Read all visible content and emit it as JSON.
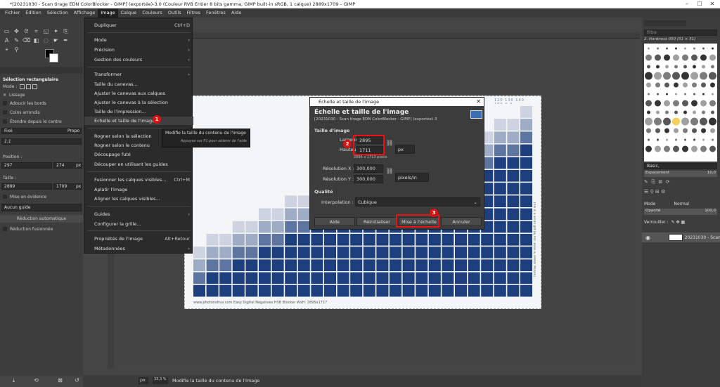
{
  "window": {
    "title": "*[20231030 - Scan tirage EDN ColorBlocker - GIMP] (exportée)-3.0 (Couleur RVB Entier 8 bits gamma, GIMP built-in sRGB, 1 calque) 2889x1709 – GIMP"
  },
  "menubar": [
    "Fichier",
    "Édition",
    "Sélection",
    "Affichage",
    "Image",
    "Calque",
    "Couleurs",
    "Outils",
    "Filtres",
    "Fenêtres",
    "Aide"
  ],
  "image_menu": {
    "items": [
      {
        "label": "Dupliquer",
        "shortcut": "Ctrl+D"
      },
      {
        "label": "Mode",
        "submenu": true
      },
      {
        "label": "Précision",
        "submenu": true
      },
      {
        "label": "Gestion des couleurs",
        "submenu": true
      },
      {
        "label": "Transformer",
        "submenu": true
      },
      {
        "label": "Taille du canevas..."
      },
      {
        "label": "Ajuster le canevas aux calques"
      },
      {
        "label": "Ajuster le canevas à la sélection"
      },
      {
        "label": "Taille de l'impression..."
      },
      {
        "label": "Échelle et taille de l'image..."
      },
      {
        "label": "Rogner selon la sélection"
      },
      {
        "label": "Rogner selon le contenu"
      },
      {
        "label": "Découpage futé"
      },
      {
        "label": "Découper en utilisant les guides"
      },
      {
        "label": "Fusionner les calques visibles...",
        "shortcut": "Ctrl+M"
      },
      {
        "label": "Aplatir l'image"
      },
      {
        "label": "Aligner les calques visibles..."
      },
      {
        "label": "Guides",
        "submenu": true
      },
      {
        "label": "Configurer la grille..."
      },
      {
        "label": "Propriétés de l'image",
        "shortcut": "Alt+Retour"
      },
      {
        "label": "Métadonnées",
        "submenu": true
      }
    ]
  },
  "tooltip": {
    "title": "Modifie la taille du contenu de l'image",
    "hint": "Appuyez sur F1 pour obtenir de l'aide"
  },
  "tool_options": {
    "title": "Sélection rectangulaire",
    "mode_label": "Mode :",
    "lissage": "Lissage",
    "adoucir": "Adoucir les bords",
    "coins": "Coins arrondis",
    "etendre": "Étendre depuis le centre",
    "fixe": "Fixé",
    "proportions": "Propo",
    "ratio": "1:1",
    "position_label": "Position :",
    "pos_x": "297",
    "pos_y": "274",
    "taille_label": "Taille :",
    "size_w": "2889",
    "size_h": "1709",
    "evidence": "Mise en évidence",
    "guide": "Aucun guide",
    "reduction_auto": "Réduction automatique",
    "reduction_fus": "Réduction fusionnée",
    "pixel_unit": "px",
    "size_unit": "px"
  },
  "dialog": {
    "window_title": "Échelle et taille de l'image",
    "heading": "Échelle et taille de l'image",
    "subheading": "[20231030 - Scan tirage EDN ColorBlocker - GIMP] (exportée)-3",
    "section_size": "Taille d'image",
    "width_label": "Largeur :",
    "width_value": "2895",
    "height_label": "Hauteur :",
    "height_value": "1711",
    "unit": "px",
    "pixels_info": "2895 x 1713 pixels",
    "resx_label": "Résolution X :",
    "resx_value": "300,000",
    "resy_label": "Résolution Y :",
    "resy_value": "300,000",
    "res_unit": "pixels/in",
    "quality_title": "Qualité",
    "interp_label": "Interpolation :",
    "interp_value": "Cubique",
    "btn_help": "Aide",
    "btn_reset": "Réinitialiser",
    "btn_scale": "Mise à l'échelle",
    "btn_cancel": "Annuler"
  },
  "badges": [
    "1",
    "2",
    "3"
  ],
  "image_content": {
    "footer": "www.photonsfrus.com     Easy Digital Negatives     HSB Blocker     WxH: 2895x1717",
    "side_text": "This is a small gift by Illo. Bilan & (Peter McKen)",
    "top_numbers": "120  130  140  150  X  X"
  },
  "right_panel": {
    "filter_placeholder": "filtre",
    "brush_name": "2. Hardness 050 (51 × 51)",
    "brush_set": "Basic,",
    "spacing_label": "Espacement",
    "spacing_value": "10,0",
    "mode_label": "Mode",
    "mode_value": "Normal",
    "opacity_label": "Opacité",
    "opacity_value": "100,0",
    "lock_label": "Verrouiller :",
    "layer_name": "20231030 - Scan"
  },
  "statusbar": {
    "unit": "px",
    "zoom": "33,3 %",
    "message": "Modifie la taille du contenu de l'image"
  },
  "colors": {
    "accent_red": "#e11111",
    "image_blue": "#1e3f7e"
  }
}
